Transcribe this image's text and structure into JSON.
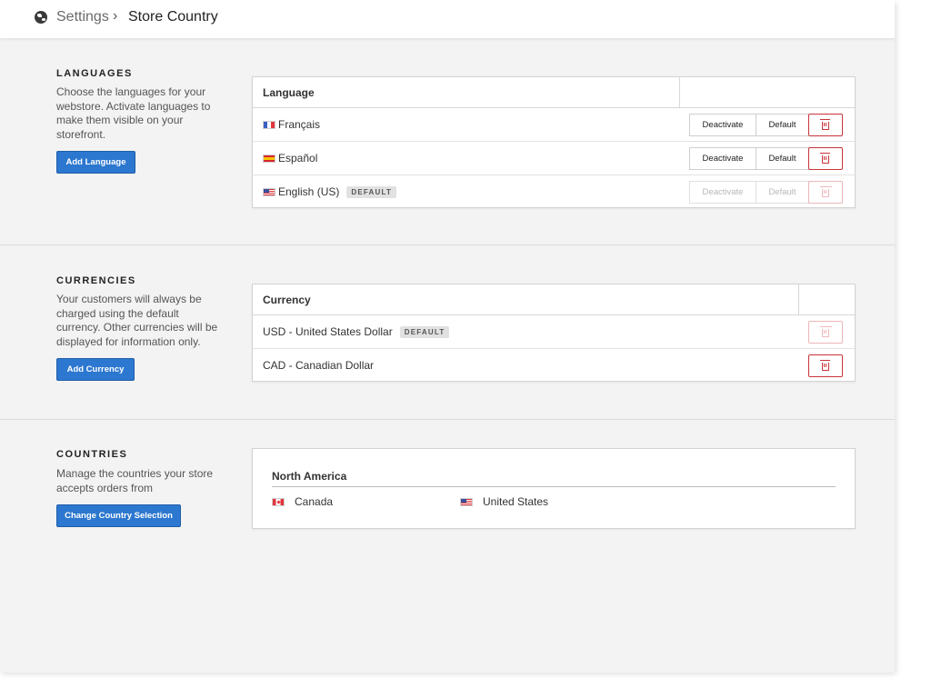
{
  "breadcrumb": {
    "icon": "globe-icon",
    "root": "Settings",
    "separator": "›",
    "current": "Store Country"
  },
  "languages": {
    "title": "LANGUAGES",
    "description": "Choose the languages for your webstore. Activate languages to make them visible on your storefront.",
    "add_button": "Add Language",
    "table_header": "Language",
    "rows": [
      {
        "flag": "flag-france-icon",
        "name": "Français",
        "badge": "",
        "deactivate": "Deactivate",
        "default": "Default",
        "enabled": true
      },
      {
        "flag": "flag-spain-icon",
        "name": "Español",
        "badge": "",
        "deactivate": "Deactivate",
        "default": "Default",
        "enabled": true
      },
      {
        "flag": "flag-usa-icon",
        "name": "English (US)",
        "badge": "DEFAULT",
        "deactivate": "Deactivate",
        "default": "Default",
        "enabled": false
      }
    ]
  },
  "currencies": {
    "title": "CURRENCIES",
    "description": "Your customers will always be charged using the default currency. Other currencies will be displayed for information only.",
    "add_button": "Add Currency",
    "table_header": "Currency",
    "rows": [
      {
        "name": "USD - United States Dollar",
        "badge": "DEFAULT",
        "enabled": false
      },
      {
        "name": "CAD - Canadian Dollar",
        "badge": "",
        "enabled": true
      }
    ]
  },
  "countries": {
    "title": "COUNTRIES",
    "description": "Manage the countries your store accepts orders from",
    "change_button": "Change Country Selection",
    "region": "North America",
    "items": [
      {
        "flag": "flag-canada-icon",
        "name": "Canada"
      },
      {
        "flag": "flag-usa-icon",
        "name": "United States"
      }
    ]
  },
  "colors": {
    "primary": "#2c77cf",
    "danger": "#c8333a",
    "background": "#f3f3f3"
  }
}
